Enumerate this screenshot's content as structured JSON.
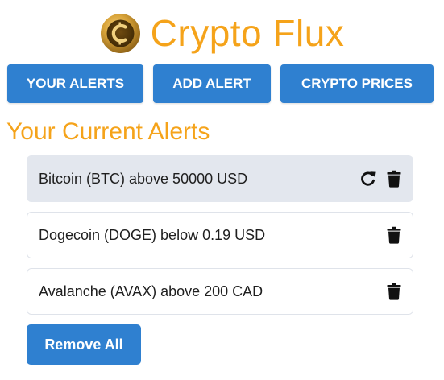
{
  "app": {
    "title": "Crypto Flux",
    "logo_icon": "bitcoin-coin-icon",
    "accent_color": "#f5a31a",
    "button_color": "#2f80d0"
  },
  "nav": {
    "your_alerts": "YOUR ALERTS",
    "add_alert": "ADD ALERT",
    "crypto_prices": "CRYPTO PRICES"
  },
  "alerts_section": {
    "title": "Your Current Alerts",
    "alerts": [
      {
        "text": "Bitcoin (BTC) above 50000 USD",
        "active": true,
        "icons": [
          "refresh-icon",
          "trash-icon"
        ]
      },
      {
        "text": "Dogecoin (DOGE) below 0.19 USD",
        "active": false,
        "icons": [
          "trash-icon"
        ]
      },
      {
        "text": "Avalanche (AVAX) above 200 CAD",
        "active": false,
        "icons": [
          "trash-icon"
        ]
      }
    ],
    "remove_all_label": "Remove All"
  }
}
